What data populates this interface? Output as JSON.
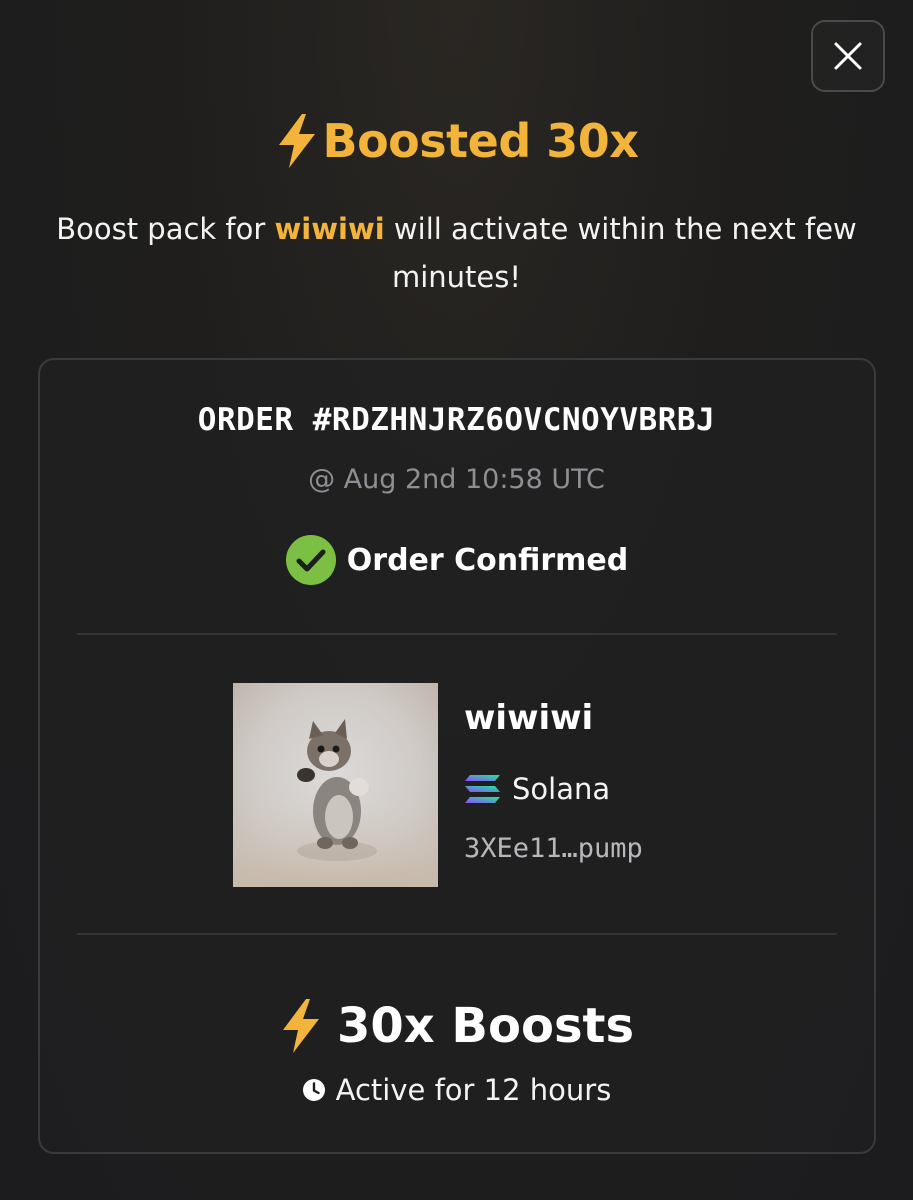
{
  "header": {
    "title": "Boosted 30x",
    "subtitle_prefix": "Boost pack for ",
    "subtitle_token": "wiwiwi",
    "subtitle_suffix": " will activate within the next few minutes!"
  },
  "order": {
    "id": "ORDER #RDZHNJRZ6OVCNOYVBRBJ",
    "time": "@ Aug 2nd 10:58 UTC",
    "status": "Order Confirmed"
  },
  "token": {
    "name": "wiwiwi",
    "chain": "Solana",
    "address": "3XEe11…pump"
  },
  "boost": {
    "label": "30x Boosts",
    "duration": "Active for 12 hours"
  },
  "colors": {
    "accent": "#f2b43a",
    "confirm": "#7bc043",
    "background": "#1c1c1e",
    "card_border": "#3a3a3d"
  },
  "icons": [
    "close-icon",
    "lightning-icon",
    "check-circle-icon",
    "solana-logo-icon",
    "clock-icon"
  ]
}
